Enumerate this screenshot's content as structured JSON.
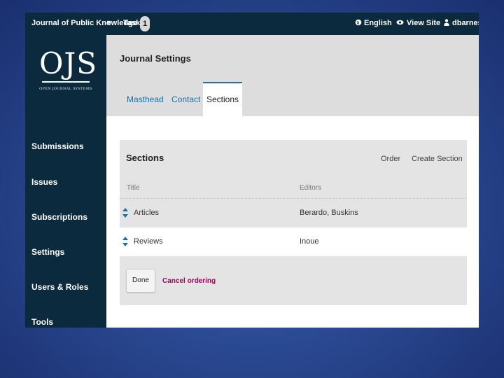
{
  "topbar": {
    "journal": "Journal of Public Knowledge",
    "journal_caret_icon": "caret-down-icon",
    "tasks_label": "Tasks",
    "tasks_count": "1",
    "language_icon": "globe-icon",
    "language": "English",
    "view_site_icon": "eye-icon",
    "view_site": "View Site",
    "user_icon": "user-icon",
    "username": "dbarnes"
  },
  "logo": {
    "big": "OJS",
    "small": "OPEN JOURNAL SYSTEMS"
  },
  "sidebar": {
    "items": [
      {
        "label": "Submissions"
      },
      {
        "label": "Issues"
      },
      {
        "label": "Subscriptions"
      },
      {
        "label": "Settings"
      },
      {
        "label": "Users & Roles"
      },
      {
        "label": "Tools"
      }
    ]
  },
  "header": {
    "title": "Journal Settings",
    "tabs": [
      {
        "label": "Masthead"
      },
      {
        "label": "Contact"
      },
      {
        "label": "Sections"
      }
    ],
    "active_tab": "Sections"
  },
  "panel": {
    "title": "Sections",
    "order_label": "Order",
    "create_label": "Create Section",
    "columns": [
      "Title",
      "Editors"
    ],
    "rows": [
      {
        "title": "Articles",
        "editors": "Berardo, Buskins"
      },
      {
        "title": "Reviews",
        "editors": "Inoue"
      }
    ],
    "done_label": "Done",
    "cancel_label": "Cancel ordering"
  },
  "colors": {
    "nav_bg": "#0c2a3e",
    "link": "#1d6fa3",
    "cancel": "#a3005c",
    "handle": "#1d6fa3"
  }
}
